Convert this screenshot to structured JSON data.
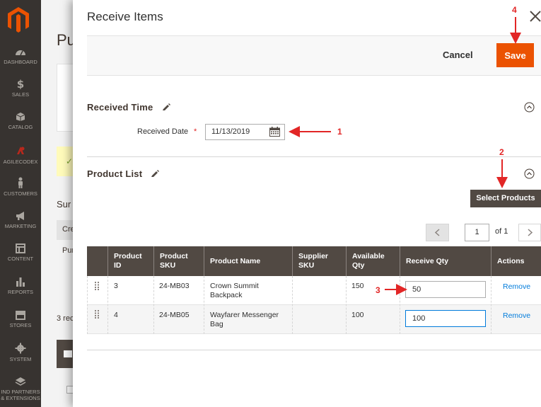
{
  "sidebar": {
    "items": [
      {
        "label": "DASHBOARD",
        "icon": "dashboard-icon"
      },
      {
        "label": "SALES",
        "icon": "dollar-icon"
      },
      {
        "label": "CATALOG",
        "icon": "cube-icon"
      },
      {
        "label": "AGILECODEX",
        "icon": "agilecodex-icon"
      },
      {
        "label": "CUSTOMERS",
        "icon": "person-icon"
      },
      {
        "label": "MARKETING",
        "icon": "megaphone-icon"
      },
      {
        "label": "CONTENT",
        "icon": "layout-icon"
      },
      {
        "label": "REPORTS",
        "icon": "bar-chart-icon"
      },
      {
        "label": "STORES",
        "icon": "store-icon"
      },
      {
        "label": "SYSTEM",
        "icon": "gear-icon"
      },
      {
        "label": "IND PARTNERS",
        "label2": "& EXTENSIONS",
        "icon": "extensions-icon"
      }
    ]
  },
  "background": {
    "title": "Pu",
    "summary": "Sur",
    "cre": "Cre",
    "pur": "Pur",
    "records": "3 rec"
  },
  "modal": {
    "title": "Receive Items",
    "cancel_label": "Cancel",
    "save_label": "Save",
    "received_time": {
      "title": "Received Time",
      "date_label": "Received Date",
      "required_mark": "*",
      "date_value": "11/13/2019"
    },
    "product_list": {
      "title": "Product List",
      "select_button": "Select Products",
      "pager": {
        "page": "1",
        "of": "of 1"
      },
      "columns": [
        "Product ID",
        "Product SKU",
        "Product Name",
        "Supplier SKU",
        "Available Qty",
        "Receive Qty",
        "Actions"
      ],
      "columns_multiline": [
        [
          "Product",
          "ID"
        ],
        [
          "Product",
          "SKU"
        ],
        [
          "Product Name"
        ],
        [
          "Supplier",
          "SKU"
        ],
        [
          "Available",
          "Qty"
        ],
        [
          "Receive Qty"
        ],
        [
          "Actions"
        ]
      ],
      "rows": [
        {
          "id": "3",
          "sku": "24-MB03",
          "name1": "Crown Summit",
          "name2": "Backpack",
          "supplier_sku": "",
          "available": "150",
          "receive_qty": "50",
          "action": "Remove"
        },
        {
          "id": "4",
          "sku": "24-MB05",
          "name1": "Wayfarer Messenger",
          "name2": "Bag",
          "supplier_sku": "",
          "available": "100",
          "receive_qty": "100",
          "action": "Remove"
        }
      ]
    }
  },
  "annotations": {
    "step1": "1",
    "step2": "2",
    "step3": "3",
    "step4": "4",
    "color": "#e22626"
  },
  "colors": {
    "accent": "#eb5202",
    "sidebar": "#373330",
    "header_dark": "#514943",
    "link": "#007bdb"
  }
}
